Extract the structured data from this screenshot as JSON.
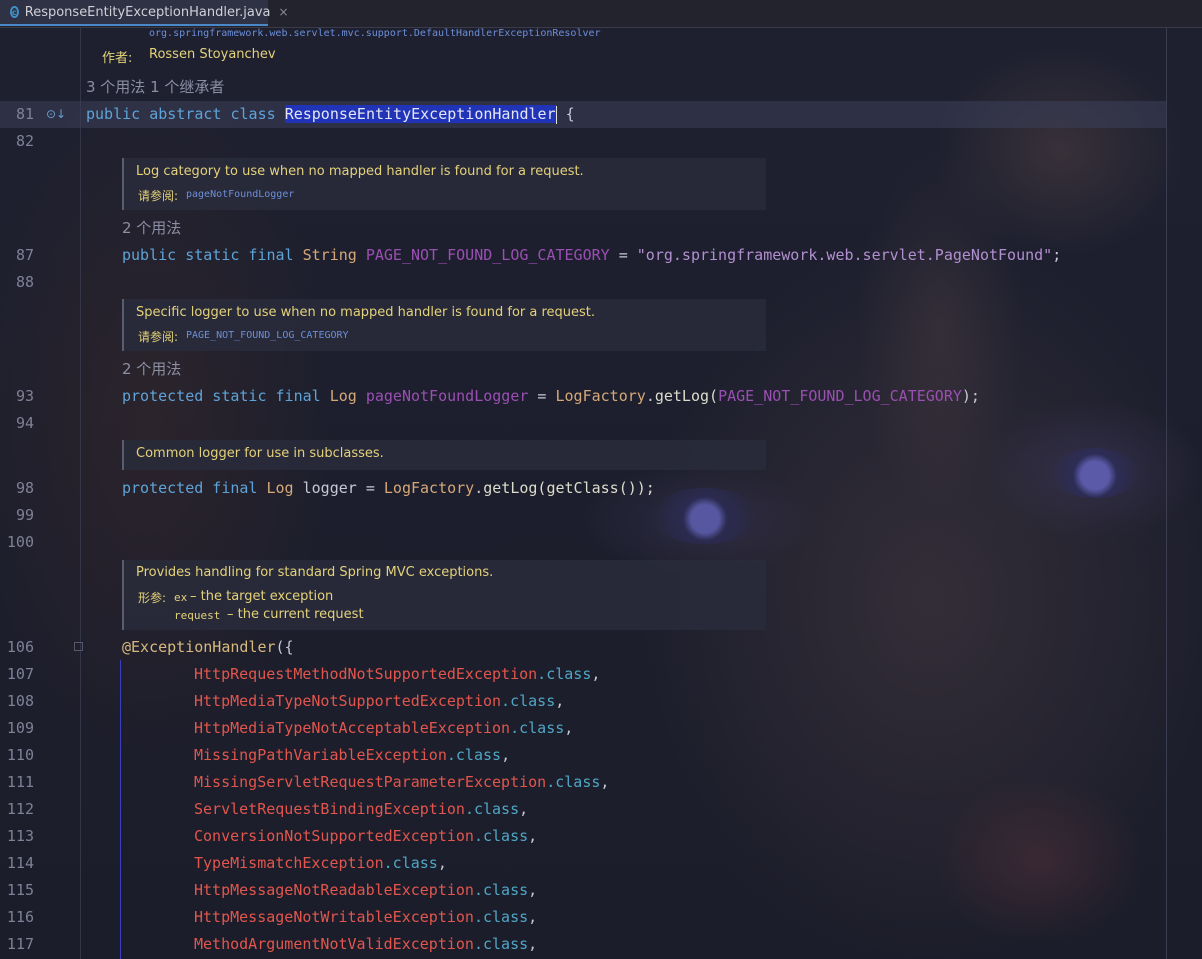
{
  "tab": {
    "filename": "ResponseEntityExceptionHandler.java",
    "close": "×"
  },
  "top_doc": {
    "ref": "org.springframework.web.servlet.mvc.support.DefaultHandlerExceptionResolver",
    "author_label": "作者:",
    "author": "Rossen Stoyanchev"
  },
  "class_usage": "3 个用法   1 个继承者",
  "lines": {
    "l81": {
      "num": "81",
      "kw": "public abstract class ",
      "name": "ResponseEntityExceptionHandler",
      "rest": " {"
    },
    "l82": {
      "num": "82"
    },
    "doc1": {
      "text": "Log category to use when no mapped handler is found for a request.",
      "see_label": "请参阅:",
      "see_ref": "pageNotFoundLogger"
    },
    "usage1": "2 个用法",
    "l87": {
      "num": "87",
      "kw": "public static final ",
      "type": "String ",
      "field": "PAGE_NOT_FOUND_LOG_CATEGORY",
      "eq": " = ",
      "str": "\"org.springframework.web.servlet.PageNotFound\"",
      "end": ";"
    },
    "l88": {
      "num": "88"
    },
    "doc2": {
      "text": "Specific logger to use when no mapped handler is found for a request.",
      "see_label": "请参阅:",
      "see_ref": "PAGE_NOT_FOUND_LOG_CATEGORY"
    },
    "usage2": "2 个用法",
    "l93": {
      "num": "93",
      "kw": "protected static final ",
      "type": "Log ",
      "field": "pageNotFoundLogger",
      "eq": " = ",
      "call": "LogFactory",
      "dot": ".",
      "fn": "getLog(",
      "arg": "PAGE_NOT_FOUND_LOG_CATEGORY",
      "end": ");"
    },
    "l94": {
      "num": "94"
    },
    "doc3": {
      "text": "Common logger for use in subclasses."
    },
    "l98": {
      "num": "98",
      "kw": "protected final ",
      "type": "Log ",
      "field": "logger",
      "eq": " = ",
      "call": "LogFactory",
      "dot": ".",
      "fn": "getLog(getClass());"
    },
    "l99": {
      "num": "99"
    },
    "l100": {
      "num": "100"
    },
    "doc4": {
      "text": "Provides handling for standard Spring MVC exceptions.",
      "params_label": "形参:",
      "p1_name": "ex",
      "p1_desc": " – the target exception",
      "p2_name": "request",
      "p2_desc": " – the current request"
    },
    "l106": {
      "num": "106",
      "ann": "@ExceptionHandler",
      "rest": "({"
    }
  },
  "exceptions": [
    {
      "num": "107",
      "name": "HttpRequestMethodNotSupportedException"
    },
    {
      "num": "108",
      "name": "HttpMediaTypeNotSupportedException"
    },
    {
      "num": "109",
      "name": "HttpMediaTypeNotAcceptableException"
    },
    {
      "num": "110",
      "name": "MissingPathVariableException"
    },
    {
      "num": "111",
      "name": "MissingServletRequestParameterException"
    },
    {
      "num": "112",
      "name": "ServletRequestBindingException"
    },
    {
      "num": "113",
      "name": "ConversionNotSupportedException"
    },
    {
      "num": "114",
      "name": "TypeMismatchException"
    },
    {
      "num": "115",
      "name": "HttpMessageNotReadableException"
    },
    {
      "num": "116",
      "name": "HttpMessageNotWritableException"
    },
    {
      "num": "117",
      "name": "MethodArgumentNotValidException"
    }
  ],
  "class_suffix": ".class",
  "comma": ",",
  "colors": {
    "keyword": "#5ea3d8",
    "field": "#9a4fb2",
    "string": "#b28fd0",
    "exception": "#e2564d",
    "javadoc": "#e4d27a",
    "selection": "#2134b8"
  }
}
